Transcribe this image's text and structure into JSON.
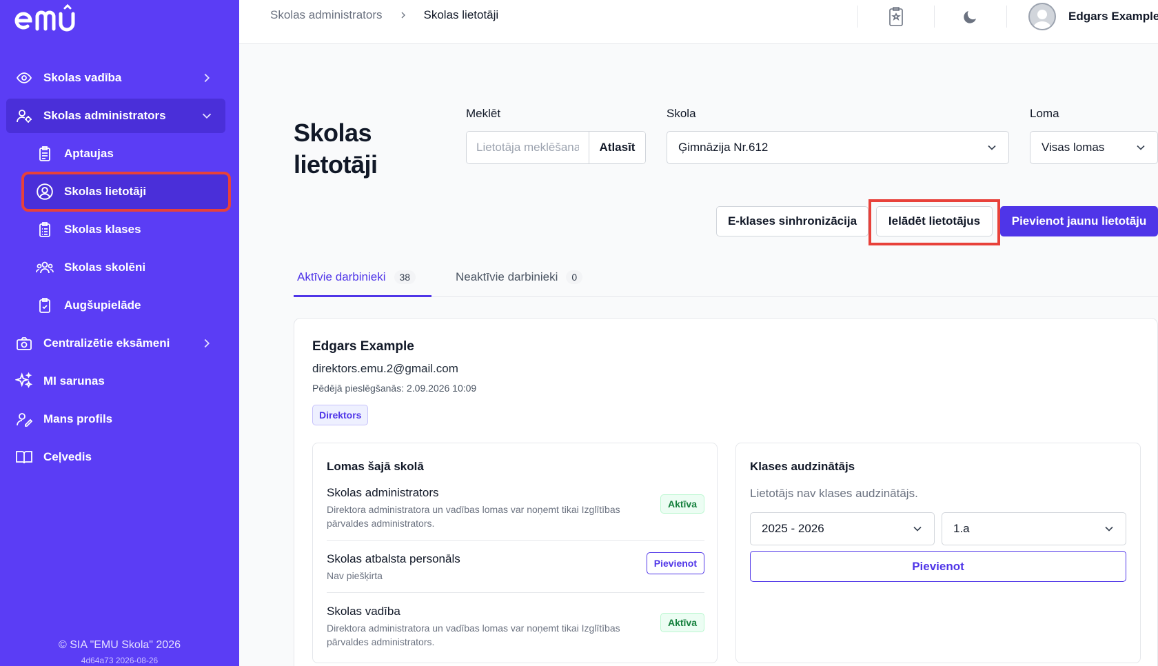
{
  "sidebar": {
    "logo_text": "emu",
    "items": [
      {
        "label": "Skolas vadība"
      },
      {
        "label": "Skolas administrators"
      },
      {
        "label": "Centralizētie eksāmeni"
      },
      {
        "label": "MI sarunas"
      },
      {
        "label": "Mans profils"
      },
      {
        "label": "Ceļvedis"
      }
    ],
    "sub_items": [
      {
        "label": "Aptaujas"
      },
      {
        "label": "Skolas lietotāji"
      },
      {
        "label": "Skolas klases"
      },
      {
        "label": "Skolas skolēni"
      },
      {
        "label": "Augšupielāde"
      }
    ],
    "footer": "© SIA \"EMU Skola\" 2026",
    "version": "4d64a73 2026-08-26"
  },
  "topbar": {
    "breadcrumb_parent": "Skolas administrators",
    "breadcrumb_current": "Skolas lietotāji",
    "user_name": "Edgars Example"
  },
  "page": {
    "title": "Skolas lietotāji"
  },
  "filters": {
    "search_label": "Meklēt",
    "search_placeholder": "Lietotāja meklēšana",
    "search_button": "Atlasīt",
    "school_label": "Skola",
    "school_value": "Ģimnāzija Nr.612",
    "role_label": "Loma",
    "role_value": "Visas lomas"
  },
  "actions": {
    "sync": "E-klases sinhronizācija",
    "load_users": "Ielādēt lietotājus",
    "add_user": "Pievienot jaunu lietotāju"
  },
  "tabs": [
    {
      "label": "Aktīvie darbinieki",
      "count": "38"
    },
    {
      "label": "Neaktīvie darbinieki",
      "count": "0"
    }
  ],
  "user_card": {
    "name": "Edgars Example",
    "email": "direktors.emu.2@gmail.com",
    "last_login": "Pēdējā pieslēgšanās: 2.09.2026 10:09",
    "badge": "Direktors",
    "roles_title": "Lomas šajā skolā",
    "roles": [
      {
        "title": "Skolas administrators",
        "desc": "Direktora administratora un vadības lomas var noņemt tikai Izglītības pārvaldes administrators.",
        "status": "Aktīva"
      },
      {
        "title": "Skolas atbalsta personāls",
        "desc": "Nav piešķirta",
        "status": "Pievienot"
      },
      {
        "title": "Skolas vadība",
        "desc": "Direktora administratora un vadības lomas var noņemt tikai Izglītības pārvaldes administrators.",
        "status": "Aktīva"
      }
    ],
    "class_teacher_title": "Klases audzinātājs",
    "class_teacher_hint": "Lietotājs nav klases audzinātājs.",
    "year_value": "2025 - 2026",
    "class_value": "1.a",
    "add_button": "Pievienot"
  },
  "colors": {
    "sidebar_bg": "#5b3df5",
    "accent": "#4f35e8",
    "highlight": "#e8413a"
  }
}
